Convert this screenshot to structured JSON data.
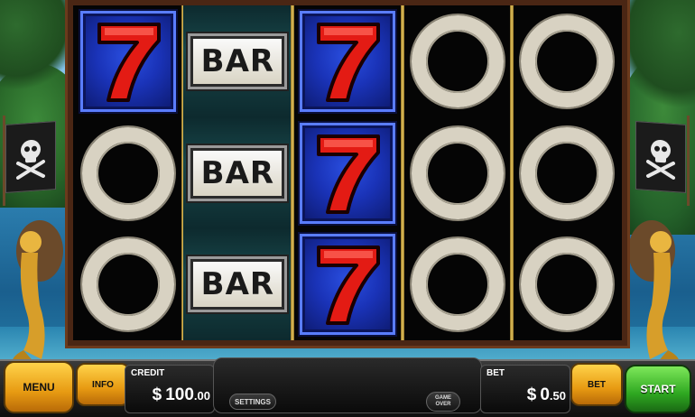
{
  "reels": [
    [
      "seven",
      "ring",
      "ring"
    ],
    [
      "bar",
      "bar",
      "bar"
    ],
    [
      "seven",
      "seven",
      "seven"
    ],
    [
      "ring",
      "ring",
      "ring"
    ],
    [
      "ring",
      "ring",
      "ring"
    ]
  ],
  "symbols": {
    "seven_label": "7",
    "bar_label": "BAR"
  },
  "controls": {
    "menu_label": "MENU",
    "info_label": "INFO",
    "bet_button_label": "BET",
    "start_label": "START",
    "settings_label": "SETTINGS",
    "game_over_line1": "GAME",
    "game_over_line2": "OVER"
  },
  "credit": {
    "label": "CREDIT",
    "currency": "$",
    "whole": "100",
    "cents": ".00"
  },
  "bet": {
    "label": "BET",
    "currency": "$",
    "whole": "0",
    "cents": ".50"
  },
  "colors": {
    "seven_red": "#e31b14",
    "seven_bg": "#1a33b8",
    "ring": "#d8d2c2",
    "button_orange": "#e79a12",
    "button_green": "#2fa821"
  }
}
